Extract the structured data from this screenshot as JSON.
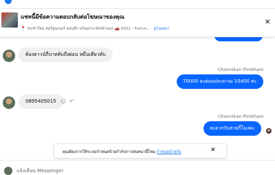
{
  "ad_banner": {
    "title": "แชทนี้มีข้อความตอบกลับต่อโฆษณาของคุณ",
    "subtitle": "รถเข้าใหม่ ฟอร์จูนเนอร์ ตอนลึก พร้อมกระจังหน้าแดง",
    "car_model": "X021 - Fortun...",
    "link_label": "ดูโฆษณา"
  },
  "messages": [
    {
      "direction": "incoming",
      "text": "ต้องดาวน์กี่บาทคับถึงผ่อน หมื่นเดียวคับ"
    },
    {
      "direction": "outgoing",
      "sender": "Chonnikan Pimkham",
      "text": "70000 จะผ่อนประมาณ 10400 คะ"
    },
    {
      "direction": "incoming",
      "text": "0895405015"
    },
    {
      "direction": "outgoing",
      "sender": "Chonnikan Pimkham",
      "text": "สะดวกรับสายกี่โมงคะ"
    }
  ],
  "notice": {
    "text": "คุณต้องการให้ระบบกำหนดป้ายกำกับการสนทนานี้ไหม",
    "link_label": "กำหนดป้ายกับ"
  },
  "bottom": {
    "text": "แจ้งเตือน Messenger"
  },
  "colors": {
    "accent": "#0866ff",
    "incoming_bubble": "#f0f0f0",
    "link": "#1877f2"
  }
}
